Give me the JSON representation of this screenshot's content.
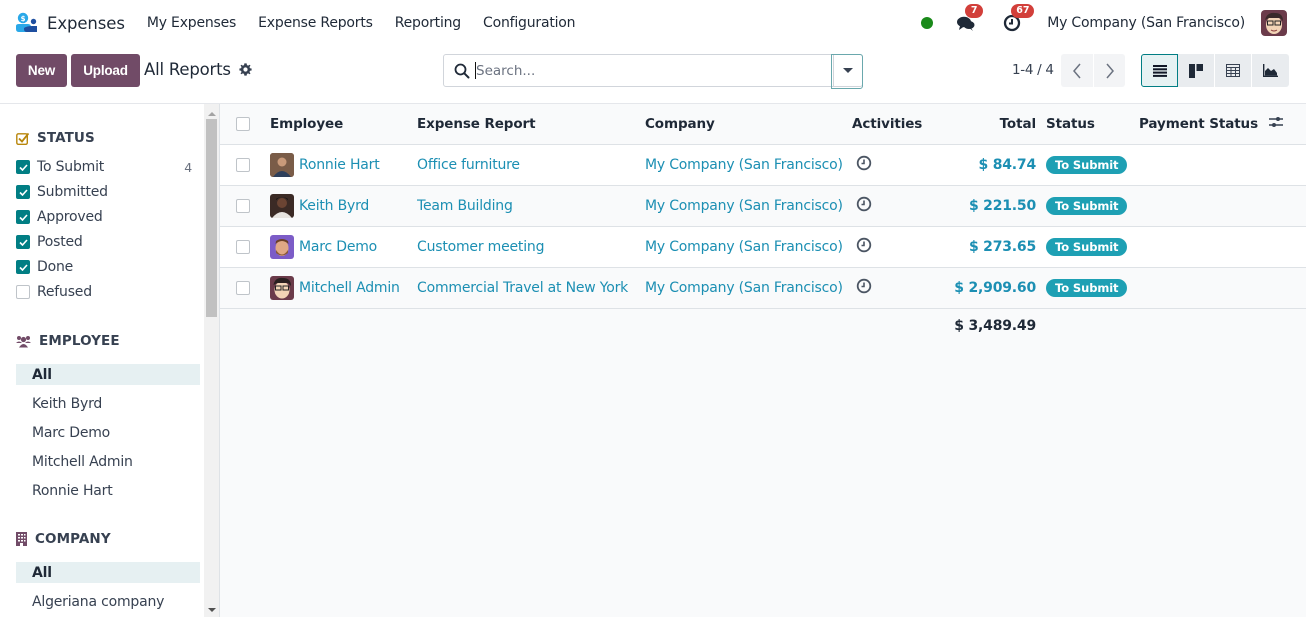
{
  "navbar": {
    "app_name": "Expenses",
    "menu": [
      "My Expenses",
      "Expense Reports",
      "Reporting",
      "Configuration"
    ],
    "messages_badge": "7",
    "activities_badge": "67",
    "company": "My Company (San Francisco)",
    "presence_status_color": "#1a8a1a"
  },
  "control_panel": {
    "new_label": "New",
    "upload_label": "Upload",
    "breadcrumb": "All Reports",
    "search_placeholder": "Search...",
    "pager": "1-4 / 4",
    "views": [
      "list",
      "kanban",
      "pivot",
      "graph"
    ],
    "active_view": "list"
  },
  "sidebar": {
    "status": {
      "title": "STATUS",
      "items": [
        {
          "label": "To Submit",
          "checked": true,
          "count": "4"
        },
        {
          "label": "Submitted",
          "checked": true,
          "count": ""
        },
        {
          "label": "Approved",
          "checked": true,
          "count": ""
        },
        {
          "label": "Posted",
          "checked": true,
          "count": ""
        },
        {
          "label": "Done",
          "checked": true,
          "count": ""
        },
        {
          "label": "Refused",
          "checked": false,
          "count": ""
        }
      ]
    },
    "employee": {
      "title": "EMPLOYEE",
      "items": [
        "All",
        "Keith Byrd",
        "Marc Demo",
        "Mitchell Admin",
        "Ronnie Hart"
      ],
      "active": "All"
    },
    "company": {
      "title": "COMPANY",
      "items": [
        "All",
        "Algeriana company"
      ],
      "active": "All"
    }
  },
  "list": {
    "columns": [
      "Employee",
      "Expense Report",
      "Company",
      "Activities",
      "Total",
      "Status",
      "Payment Status"
    ],
    "rows": [
      {
        "employee": "Ronnie Hart",
        "report": "Office furniture",
        "company": "My Company (San Francisco)",
        "activity_icon": "clock-icon",
        "total": "$ 84.74",
        "status": "To Submit",
        "payment_status": ""
      },
      {
        "employee": "Keith Byrd",
        "report": "Team Building",
        "company": "My Company (San Francisco)",
        "activity_icon": "clock-icon",
        "total": "$ 221.50",
        "status": "To Submit",
        "payment_status": ""
      },
      {
        "employee": "Marc Demo",
        "report": "Customer meeting",
        "company": "My Company (San Francisco)",
        "activity_icon": "clock-icon",
        "total": "$ 273.65",
        "status": "To Submit",
        "payment_status": ""
      },
      {
        "employee": "Mitchell Admin",
        "report": "Commercial Travel at New York",
        "company": "My Company (San Francisco)",
        "activity_icon": "clock-icon",
        "total": "$ 2,909.60",
        "status": "To Submit",
        "payment_status": ""
      }
    ],
    "grand_total": "$ 3,489.49"
  },
  "colors": {
    "primary": "#714b67",
    "accent": "#017e84",
    "link": "#1c8fb3",
    "status_pill": "#1ea0b4",
    "badge": "#d23f3a"
  }
}
